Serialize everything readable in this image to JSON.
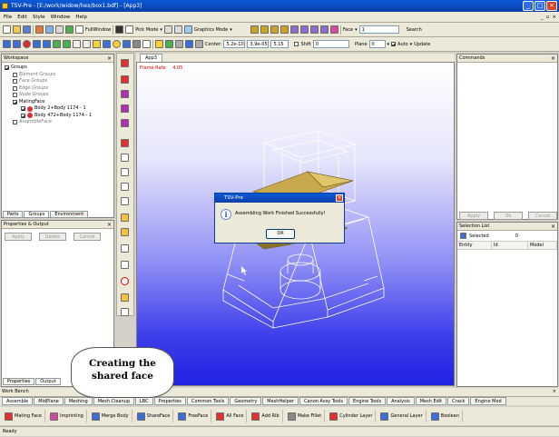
{
  "window": {
    "title": "TSV-Pre - [E:/work/widow/hex/box1.bdf] - [App3]",
    "btn_min": "_",
    "btn_max": "□",
    "btn_close": "×"
  },
  "menu": {
    "items": [
      "File",
      "Edit",
      "Style",
      "Window",
      "Help"
    ],
    "mdi": [
      "_",
      "▫",
      "×"
    ]
  },
  "toolbar1": {
    "fullwindow": "FullWindow",
    "pickmode": "Pick Mode",
    "graphicsmode": "Graphics Mode",
    "face_label": "Face",
    "face_value": "1",
    "search_label": "Search"
  },
  "toolbar2": {
    "center_label": "Center:",
    "cx": "5.2e-10",
    "cy": "3.9e-05",
    "cz": "5.15",
    "shift_label": "Shift",
    "shift_value": "0",
    "plane_label": "Plane",
    "plane_value": "0",
    "auto_label": "Auto",
    "update_label": "Update"
  },
  "workspace": {
    "title": "Workspace",
    "close": "×",
    "tree": [
      {
        "label": "Groups",
        "indent": 0,
        "checked": true,
        "italic": false
      },
      {
        "label": "Element Groups",
        "indent": 1,
        "checked": false,
        "italic": true
      },
      {
        "label": "Face Groups",
        "indent": 1,
        "checked": false,
        "italic": true
      },
      {
        "label": "Edge Groups",
        "indent": 1,
        "checked": false,
        "italic": true
      },
      {
        "label": "Node Groups",
        "indent": 1,
        "checked": false,
        "italic": true
      },
      {
        "label": "MatingFace",
        "indent": 1,
        "checked": true,
        "italic": false
      },
      {
        "label": "Body 2+Body 1174 - 1",
        "indent": 2,
        "checked": true,
        "italic": false
      },
      {
        "label": "Body 472+Body 1174 - 1",
        "indent": 2,
        "checked": true,
        "italic": false
      },
      {
        "label": "AssembleFace",
        "indent": 1,
        "checked": false,
        "italic": true
      }
    ],
    "tabs": [
      "Parts",
      "Groups",
      "Environment"
    ]
  },
  "props": {
    "title": "Properties & Output",
    "close": "×",
    "buttons": [
      "Apply",
      "Delete",
      "Cancel"
    ],
    "tabs": [
      "Properties",
      "Output"
    ]
  },
  "viewport": {
    "tab": "App3",
    "frame_rate_label": "Frame Rate",
    "frame_rate_value": "4.05"
  },
  "dialog": {
    "title": "TSV-Pre",
    "close": "×",
    "icon": "i",
    "message": "Assembling Work Finished Successfully!",
    "ok": "OK"
  },
  "commands": {
    "title": "Commands",
    "close": "×",
    "buttons": [
      "Apply",
      "Ok",
      "Cancel"
    ]
  },
  "selection": {
    "title": "Selection List",
    "close": "×",
    "selected_label": "Selected",
    "selected_count": "0",
    "columns": [
      "Entity",
      "Id",
      "Model"
    ]
  },
  "callout": {
    "line1": "Creating the",
    "line2": "shared face"
  },
  "workbench": {
    "title": "Work Bench",
    "close": "×",
    "tabs": [
      "Assemble",
      "MidPlane",
      "Meshing",
      "Mesh Cleanup",
      "LBC",
      "Properties",
      "Common Tools",
      "Geometry",
      "MeshHelper",
      "Canon Assy Tools",
      "Engine Tools",
      "Analysis",
      "Mesh Edit",
      "Crack",
      "Engine Mod"
    ],
    "tools": [
      "Mating Face",
      "Imprinting",
      "Merge Body",
      "ShareFace",
      "FreeFace",
      "All Face",
      "Add Rib",
      "Make Fillet",
      "Cylinder Layer",
      "General Layer",
      "Boolean"
    ]
  },
  "status": {
    "text": "Ready"
  },
  "colors": {
    "title_blue": "#0b46c2",
    "viewport_top": "#ffffff",
    "viewport_bottom": "#2121e2",
    "mating_face": "#c8a84a"
  }
}
